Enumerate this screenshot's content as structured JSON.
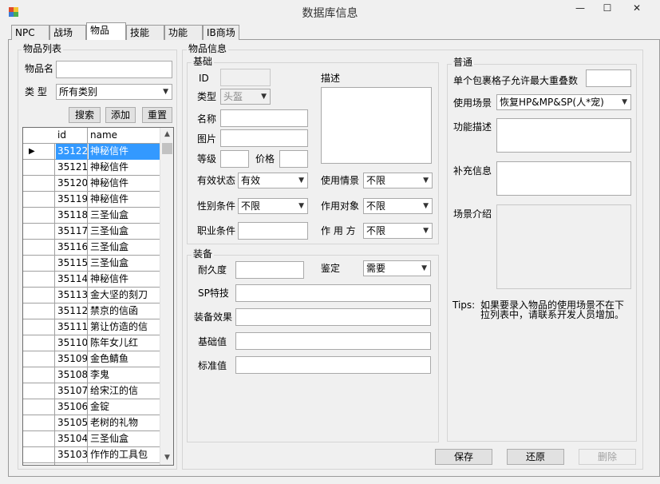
{
  "window": {
    "title": "数据库信息",
    "minimize_label": "—",
    "maximize_label": "☐",
    "close_label": "✕"
  },
  "tabs": [
    {
      "label": "NPC"
    },
    {
      "label": "战场"
    },
    {
      "label": "物品"
    },
    {
      "label": "技能"
    },
    {
      "label": "功能"
    },
    {
      "label": "IB商场"
    }
  ],
  "item_list": {
    "group_label": "物品列表",
    "name_label": "物品名",
    "name_value": "",
    "type_label": "类  型",
    "type_value": "所有类别",
    "search_label": "搜索",
    "add_label": "添加",
    "reset_label": "重置",
    "columns": {
      "id": "id",
      "name": "name"
    },
    "rows": [
      {
        "id": "35122",
        "name": "神秘信件"
      },
      {
        "id": "35121",
        "name": "神秘信件"
      },
      {
        "id": "35120",
        "name": "神秘信件"
      },
      {
        "id": "35119",
        "name": "神秘信件"
      },
      {
        "id": "35118",
        "name": "三圣仙盒"
      },
      {
        "id": "35117",
        "name": "三圣仙盒"
      },
      {
        "id": "35116",
        "name": "三圣仙盒"
      },
      {
        "id": "35115",
        "name": "三圣仙盒"
      },
      {
        "id": "35114",
        "name": "神秘信件"
      },
      {
        "id": "35113",
        "name": "金大坚的刻刀"
      },
      {
        "id": "35112",
        "name": "禁京的信函"
      },
      {
        "id": "35111",
        "name": "第让仿造的信"
      },
      {
        "id": "35110",
        "name": "陈年女儿红"
      },
      {
        "id": "35109",
        "name": "金色鲭鱼"
      },
      {
        "id": "35108",
        "name": "李鬼"
      },
      {
        "id": "35107",
        "name": "给宋江的信"
      },
      {
        "id": "35106",
        "name": "金锭"
      },
      {
        "id": "35105",
        "name": "老树的礼物"
      },
      {
        "id": "35104",
        "name": "三圣仙盒"
      },
      {
        "id": "35103",
        "name": "作作的工具包"
      }
    ]
  },
  "item_info": {
    "group_label": "物品信息",
    "basic": {
      "group_label": "基础",
      "id_label": "ID",
      "id_value": "",
      "type_label": "类型",
      "type_value": "头盔",
      "name_label": "名称",
      "image_label": "图片",
      "level_label": "等级",
      "price_label": "价格",
      "desc_label": "描述",
      "valid_label": "有效状态",
      "valid_value": "有效",
      "gender_label": "性别条件",
      "gender_value": "不限",
      "job_label": "职业条件",
      "use_scene_label": "使用情景",
      "use_scene_value": "不限",
      "target_label": "作用对象",
      "target_value": "不限",
      "side_label": "作 用 方",
      "side_value": "不限"
    },
    "equip": {
      "group_label": "装备",
      "durability_label": "耐久度",
      "identify_label": "鉴定",
      "identify_value": "需要",
      "sp_label": "SP特技",
      "effect_label": "装备效果",
      "base_label": "基础值",
      "standard_label": "标准值"
    }
  },
  "general": {
    "group_label": "普通",
    "stack_label": "单个包裹格子允许最大重叠数",
    "scene_label": "使用场景",
    "scene_value": "恢复HP&MP&SP(人*宠)",
    "func_desc_label": "功能描述",
    "extra_label": "补充信息",
    "scene_intro_label": "场景介绍",
    "tips_label": "Tips:",
    "tips_line1": "如果要录入物品的使用场景不在下",
    "tips_line2": "拉列表中，请联系开发人员增加。"
  },
  "actions": {
    "save_label": "保存",
    "restore_label": "还原",
    "delete_label": "删除"
  }
}
